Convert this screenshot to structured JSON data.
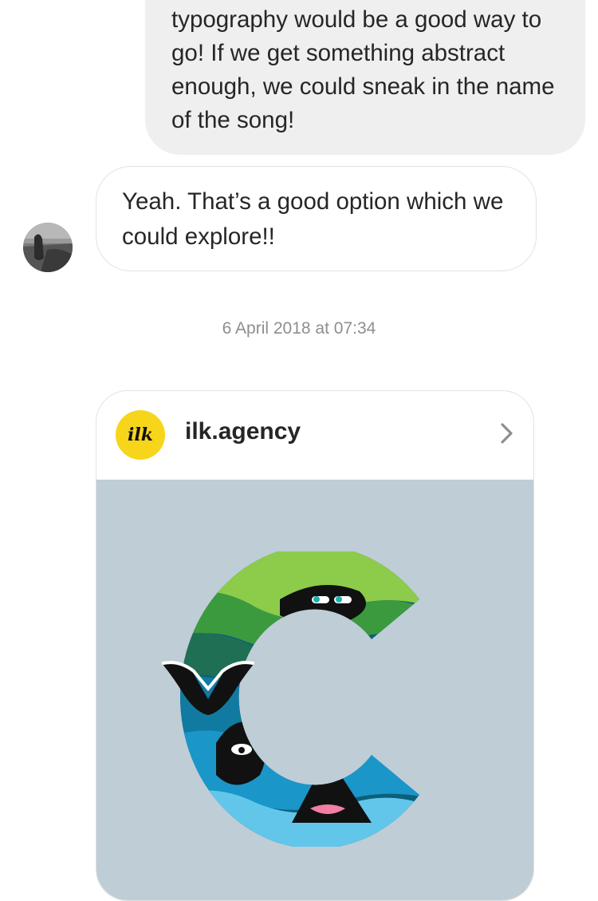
{
  "messages": {
    "outgoing_text": "typography would be a good way to go! If we get something abstract enough, we could sneak in the name of the song!",
    "incoming_text": "Yeah. That’s a good option which we could explore!!"
  },
  "timestamp": "6 April 2018 at 07:34",
  "shared_post": {
    "username": "ilk.agency",
    "logo_text": "ilk",
    "logo_color": "#f7d51b",
    "image_bg": "#bfcdd6"
  }
}
